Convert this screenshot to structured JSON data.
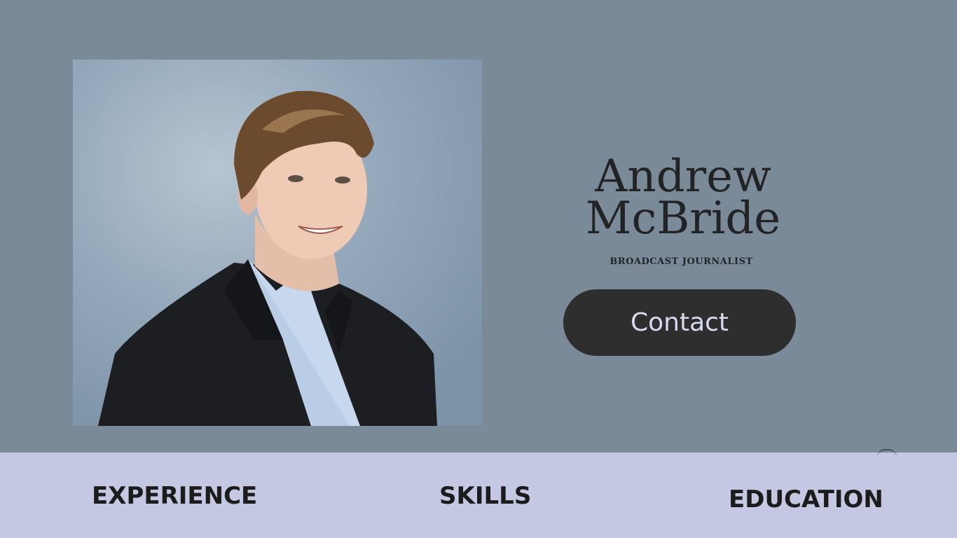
{
  "profile": {
    "first_name": "Andrew",
    "last_name": "McBride",
    "title": "BROADCAST JOURNALIST"
  },
  "actions": {
    "contact_label": "Contact"
  },
  "nav": {
    "experience": "EXPERIENCE",
    "skills": "SKILLS",
    "education": "EDUCATION"
  },
  "colors": {
    "hero_background": "#7b8a99",
    "nav_background": "#c4c8e2",
    "button_background": "#2e2e2e",
    "button_text": "#d6dbee",
    "text_dark": "#222325"
  },
  "icons": {
    "portrait": "person-photo"
  }
}
